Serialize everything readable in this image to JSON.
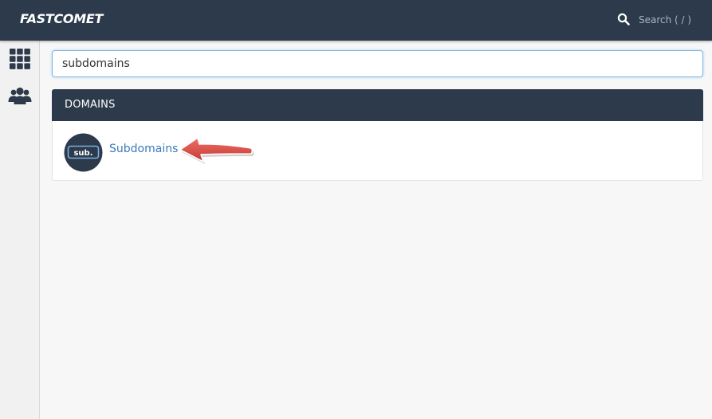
{
  "header": {
    "logo_text": "FASTCOMET",
    "search_label": "Search ( / )",
    "background_color": "#2c3a4b"
  },
  "sidebar": {
    "items": [
      {
        "icon": "grid-icon"
      },
      {
        "icon": "users-icon"
      }
    ]
  },
  "search": {
    "value": "subdomains"
  },
  "results": {
    "group_title": "DOMAINS",
    "items": [
      {
        "label": "Subdomains",
        "icon": "subdomains-icon",
        "icon_text": "sub."
      }
    ]
  },
  "annotation": {
    "arrow_color": "#d9453f"
  }
}
